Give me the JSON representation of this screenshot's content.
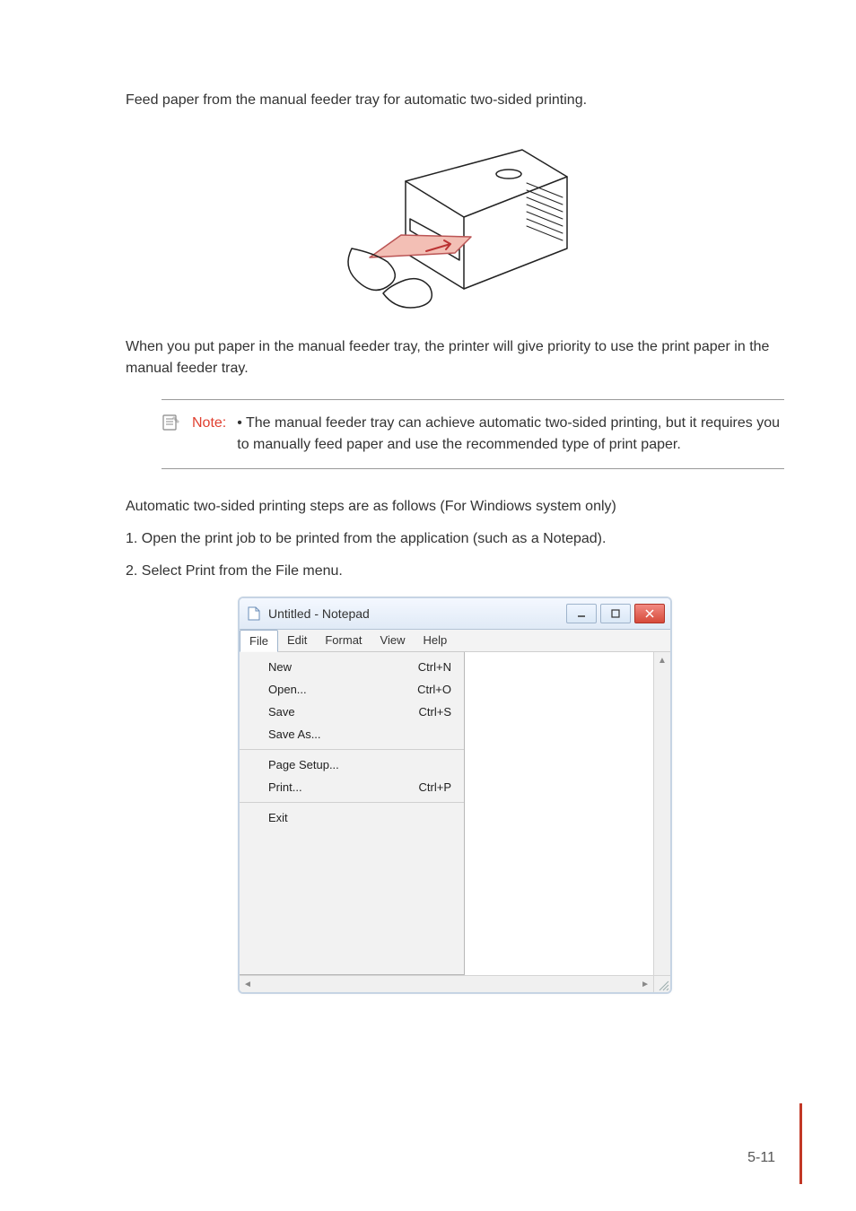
{
  "body": {
    "p1": "Feed paper from the manual feeder tray for automatic two-sided printing.",
    "p2": "When you put paper in the manual feeder tray, the printer will give priority to use the print paper in the manual feeder tray.",
    "p_steps_intro": "Automatic two-sided printing steps are as follows (For Windiows system only)",
    "step1": "1. Open the print job to be printed from the application (such as a Notepad).",
    "step2": "2. Select Print from the File menu."
  },
  "note": {
    "label": "Note:",
    "text": "• The manual feeder tray can achieve automatic two-sided printing, but it requires you to manually feed paper and use the recommended type of print paper."
  },
  "notepad": {
    "title": "Untitled - Notepad",
    "menu": {
      "file": "File",
      "edit": "Edit",
      "format": "Format",
      "view": "View",
      "help": "Help"
    },
    "items": {
      "new": {
        "label": "New",
        "shortcut": "Ctrl+N"
      },
      "open": {
        "label": "Open...",
        "shortcut": "Ctrl+O"
      },
      "save": {
        "label": "Save",
        "shortcut": "Ctrl+S"
      },
      "saveas": {
        "label": "Save As...",
        "shortcut": ""
      },
      "pagesetup": {
        "label": "Page Setup...",
        "shortcut": ""
      },
      "print": {
        "label": "Print...",
        "shortcut": "Ctrl+P"
      },
      "exit": {
        "label": "Exit",
        "shortcut": ""
      }
    }
  },
  "page_number": "5-11"
}
